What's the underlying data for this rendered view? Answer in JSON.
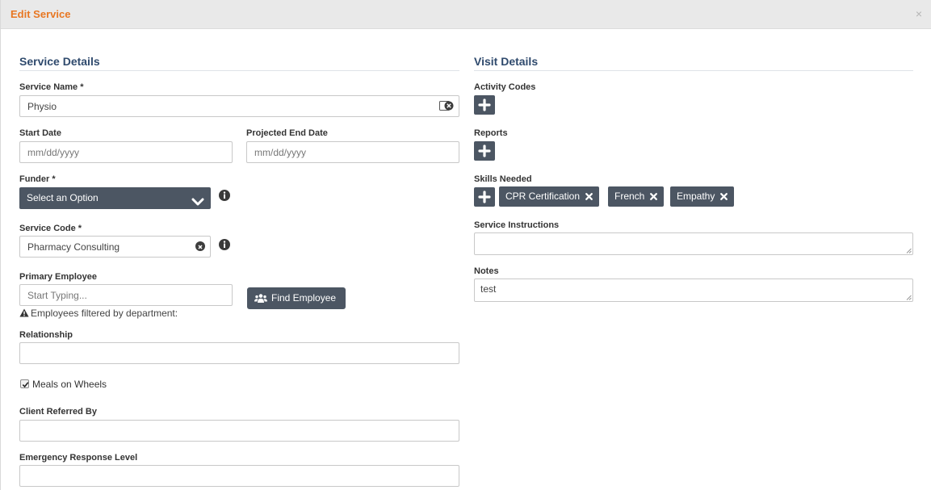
{
  "modal": {
    "title": "Edit Service",
    "close_label": "×"
  },
  "service_details": {
    "heading": "Service Details",
    "service_name": {
      "label": "Service Name *",
      "value": "Physio"
    },
    "start_date": {
      "label": "Start Date",
      "placeholder": "mm/dd/yyyy"
    },
    "projected_end_date": {
      "label": "Projected End Date",
      "placeholder": "mm/dd/yyyy"
    },
    "funder": {
      "label": "Funder *",
      "selected": "Select an Option"
    },
    "service_code": {
      "label": "Service Code *",
      "value": "Pharmacy Consulting"
    },
    "primary_employee": {
      "label": "Primary Employee",
      "placeholder": "Start Typing...",
      "note": "Employees filtered by department:",
      "find_button_label": "Find Employee"
    },
    "relationship": {
      "label": "Relationship",
      "value": ""
    },
    "meals_on_wheels": {
      "label": "Meals on Wheels",
      "checked": true
    },
    "client_referred_by": {
      "label": "Client Referred By",
      "value": ""
    },
    "emergency_response_level": {
      "label": "Emergency Response Level",
      "value": ""
    }
  },
  "visit_details": {
    "heading": "Visit Details",
    "activity_codes": {
      "label": "Activity Codes"
    },
    "reports": {
      "label": "Reports"
    },
    "skills_needed": {
      "label": "Skills Needed",
      "skills": [
        "CPR Certification",
        "French",
        "Empathy"
      ]
    },
    "service_instructions": {
      "label": "Service Instructions",
      "value": ""
    },
    "notes": {
      "label": "Notes",
      "value": "test"
    }
  },
  "colors": {
    "accent_title": "#e87722",
    "section_heading": "#2f4a6d",
    "button_dark": "#4c5663"
  },
  "icons": [
    "close-icon",
    "clear-input-icon",
    "chevron-down-icon",
    "info-icon",
    "clear-icon",
    "users-icon",
    "warning-icon",
    "plus-icon",
    "remove-chip-icon",
    "checkbox-check-icon"
  ]
}
